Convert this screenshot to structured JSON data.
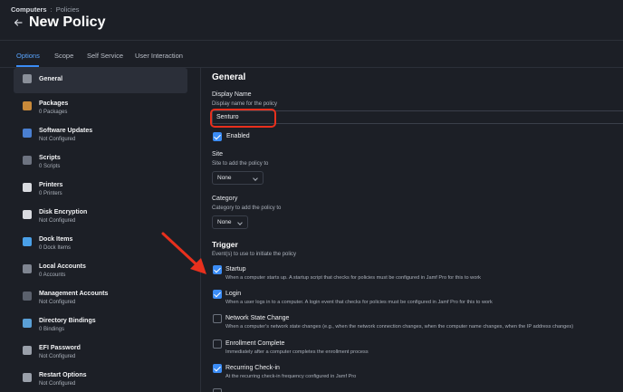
{
  "header": {
    "breadcrumb_root": "Computers",
    "breadcrumb_sep": ":",
    "breadcrumb_current": "Policies",
    "title": "New Policy"
  },
  "tabs": [
    {
      "label": "Options"
    },
    {
      "label": "Scope"
    },
    {
      "label": "Self Service"
    },
    {
      "label": "User Interaction"
    }
  ],
  "sidebar": {
    "items": [
      {
        "name": "General",
        "sub": "",
        "icon": "general-icon",
        "color": "#8a8f99"
      },
      {
        "name": "Packages",
        "sub": "0 Packages",
        "icon": "package-icon",
        "color": "#c98a3a"
      },
      {
        "name": "Software Updates",
        "sub": "Not Configured",
        "icon": "software-update-icon",
        "color": "#4a7fd1"
      },
      {
        "name": "Scripts",
        "sub": "0 Scripts",
        "icon": "script-icon",
        "color": "#6d7380"
      },
      {
        "name": "Printers",
        "sub": "0 Printers",
        "icon": "printer-icon",
        "color": "#d9dbe0"
      },
      {
        "name": "Disk Encryption",
        "sub": "Not Configured",
        "icon": "disk-encryption-icon",
        "color": "#d9dbe0"
      },
      {
        "name": "Dock Items",
        "sub": "0 Dock Items",
        "icon": "dock-icon",
        "color": "#4aa0e8"
      },
      {
        "name": "Local Accounts",
        "sub": "0 Accounts",
        "icon": "local-account-icon",
        "color": "#7f8591"
      },
      {
        "name": "Management Accounts",
        "sub": "Not Configured",
        "icon": "management-account-icon",
        "color": "#5b616d"
      },
      {
        "name": "Directory Bindings",
        "sub": "0 Bindings",
        "icon": "directory-binding-icon",
        "color": "#5a9fd6"
      },
      {
        "name": "EFI Password",
        "sub": "Not Configured",
        "icon": "efi-password-icon",
        "color": "#9aa0aa"
      },
      {
        "name": "Restart Options",
        "sub": "Not Configured",
        "icon": "restart-icon",
        "color": "#9aa0aa"
      }
    ]
  },
  "general": {
    "title": "General",
    "display_name_label": "Display Name",
    "display_name_help": "Display name for the policy",
    "display_name_value": "Senturo",
    "enabled_label": "Enabled",
    "enabled": true,
    "site_label": "Site",
    "site_help": "Site to add the policy to",
    "site_value": "None",
    "category_label": "Category",
    "category_help": "Category to add the policy to",
    "category_value": "None"
  },
  "trigger": {
    "title": "Trigger",
    "help": "Event(s) to use to initiate the policy",
    "items": [
      {
        "label": "Startup",
        "desc": "When a computer starts up. A startup script that checks for policies must be configured in Jamf Pro for this to work",
        "checked": true
      },
      {
        "label": "Login",
        "desc": "When a user logs in to a computer. A login event that checks for policies must be configured in Jamf Pro for this to work",
        "checked": true
      },
      {
        "label": "Network State Change",
        "desc": "When a computer's network state changes (e.g., when the network connection changes, when the computer name changes, when the IP address changes)",
        "checked": false
      },
      {
        "label": "Enrollment Complete",
        "desc": "Immediately after a computer completes the enrollment process",
        "checked": false
      },
      {
        "label": "Recurring Check-in",
        "desc": "At the recurring check-in frequency configured in Jamf Pro",
        "checked": true
      }
    ]
  },
  "colors": {
    "accent": "#3b8cf5",
    "annotation": "#e8301d"
  }
}
